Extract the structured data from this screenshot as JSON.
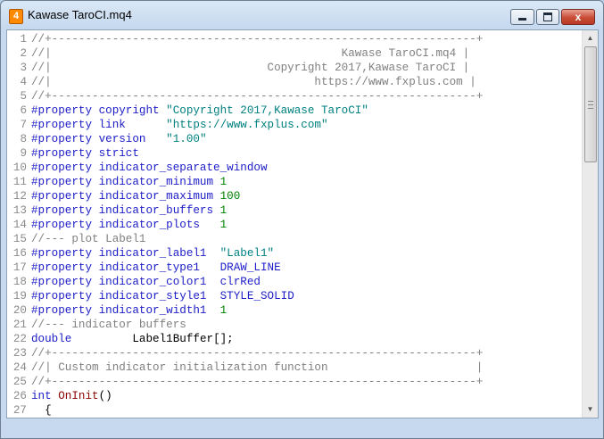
{
  "window": {
    "title": "Kawase TaroCI.mq4",
    "app_icon_glyph": "4",
    "close_glyph": "x"
  },
  "editor": {
    "lines": [
      {
        "n": "1",
        "tokens": [
          {
            "t": "//+---------------------------------------------------------------+",
            "c": "comment"
          }
        ]
      },
      {
        "n": "2",
        "tokens": [
          {
            "t": "//|                                           Kawase TaroCI.mq4 |",
            "c": "comment"
          }
        ]
      },
      {
        "n": "3",
        "tokens": [
          {
            "t": "//|                                Copyright 2017,Kawase TaroCI |",
            "c": "comment"
          }
        ]
      },
      {
        "n": "4",
        "tokens": [
          {
            "t": "//|                                       https://www.fxplus.com |",
            "c": "comment"
          }
        ]
      },
      {
        "n": "5",
        "tokens": [
          {
            "t": "//+---------------------------------------------------------------+",
            "c": "comment"
          }
        ]
      },
      {
        "n": "6",
        "tokens": [
          {
            "t": "#property copyright ",
            "c": "kw"
          },
          {
            "t": "\"Copyright 2017,Kawase TaroCI\"",
            "c": "str"
          }
        ]
      },
      {
        "n": "7",
        "tokens": [
          {
            "t": "#property link      ",
            "c": "kw"
          },
          {
            "t": "\"https://www.fxplus.com\"",
            "c": "str"
          }
        ]
      },
      {
        "n": "8",
        "tokens": [
          {
            "t": "#property version   ",
            "c": "kw"
          },
          {
            "t": "\"1.00\"",
            "c": "str"
          }
        ]
      },
      {
        "n": "9",
        "tokens": [
          {
            "t": "#property strict",
            "c": "kw"
          }
        ]
      },
      {
        "n": "10",
        "tokens": [
          {
            "t": "#property indicator_separate_window",
            "c": "kw"
          }
        ]
      },
      {
        "n": "11",
        "tokens": [
          {
            "t": "#property indicator_minimum ",
            "c": "kw"
          },
          {
            "t": "1",
            "c": "num"
          }
        ]
      },
      {
        "n": "12",
        "tokens": [
          {
            "t": "#property indicator_maximum ",
            "c": "kw"
          },
          {
            "t": "100",
            "c": "num"
          }
        ]
      },
      {
        "n": "13",
        "tokens": [
          {
            "t": "#property indicator_buffers ",
            "c": "kw"
          },
          {
            "t": "1",
            "c": "num"
          }
        ]
      },
      {
        "n": "14",
        "tokens": [
          {
            "t": "#property indicator_plots   ",
            "c": "kw"
          },
          {
            "t": "1",
            "c": "num"
          }
        ]
      },
      {
        "n": "15",
        "tokens": [
          {
            "t": "//--- plot Label1",
            "c": "comment"
          }
        ]
      },
      {
        "n": "16",
        "tokens": [
          {
            "t": "#property indicator_label1  ",
            "c": "kw"
          },
          {
            "t": "\"Label1\"",
            "c": "str"
          }
        ]
      },
      {
        "n": "17",
        "tokens": [
          {
            "t": "#property indicator_type1   ",
            "c": "kw"
          },
          {
            "t": "DRAW_LINE",
            "c": "const"
          }
        ]
      },
      {
        "n": "18",
        "tokens": [
          {
            "t": "#property indicator_color1  ",
            "c": "kw"
          },
          {
            "t": "clrRed",
            "c": "const"
          }
        ]
      },
      {
        "n": "19",
        "tokens": [
          {
            "t": "#property indicator_style1  ",
            "c": "kw"
          },
          {
            "t": "STYLE_SOLID",
            "c": "const"
          }
        ]
      },
      {
        "n": "20",
        "tokens": [
          {
            "t": "#property indicator_width1  ",
            "c": "kw"
          },
          {
            "t": "1",
            "c": "num"
          }
        ]
      },
      {
        "n": "21",
        "tokens": [
          {
            "t": "//--- indicator buffers",
            "c": "comment"
          }
        ]
      },
      {
        "n": "22",
        "tokens": [
          {
            "t": "double",
            "c": "kw"
          },
          {
            "t": "         Label1Buffer[];",
            "c": "plain"
          }
        ]
      },
      {
        "n": "23",
        "tokens": [
          {
            "t": "//+---------------------------------------------------------------+",
            "c": "comment"
          }
        ]
      },
      {
        "n": "24",
        "tokens": [
          {
            "t": "//| Custom indicator initialization function                      |",
            "c": "comment"
          }
        ]
      },
      {
        "n": "25",
        "tokens": [
          {
            "t": "//+---------------------------------------------------------------+",
            "c": "comment"
          }
        ]
      },
      {
        "n": "26",
        "tokens": [
          {
            "t": "int",
            "c": "kw"
          },
          {
            "t": " ",
            "c": "plain"
          },
          {
            "t": "OnInit",
            "c": "func"
          },
          {
            "t": "()",
            "c": "plain"
          }
        ]
      },
      {
        "n": "27",
        "tokens": [
          {
            "t": "  {",
            "c": "plain"
          }
        ]
      }
    ]
  },
  "scrollbar": {
    "up_glyph": "▲",
    "down_glyph": "▼"
  }
}
